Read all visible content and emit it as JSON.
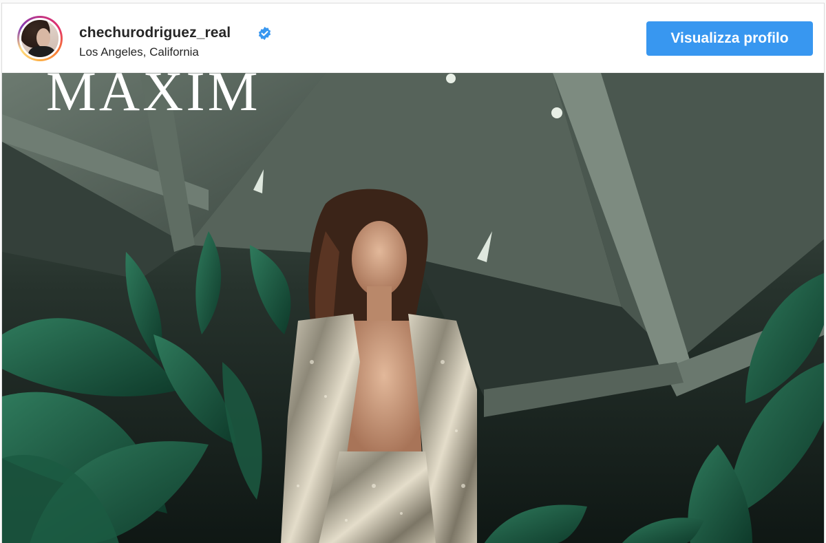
{
  "post": {
    "username": "chechurodriguez_real",
    "location": "Los Angeles, California",
    "verified_icon": "verified-badge-icon",
    "view_profile_label": "Visualizza profilo",
    "accent_color": "#3897f0"
  },
  "image": {
    "magazine_title": "MAXIM"
  }
}
